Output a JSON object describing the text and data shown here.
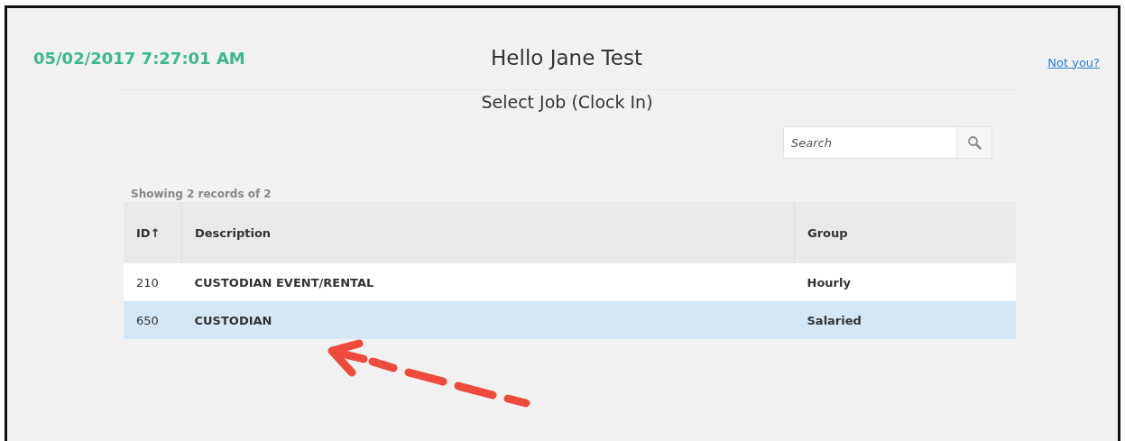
{
  "timestamp": "05/02/2017 7:27:01 AM",
  "greeting": "Hello Jane Test",
  "not_you_link": "Not you?",
  "subtitle": "Select Job (Clock In)",
  "search": {
    "placeholder": "Search"
  },
  "records_summary": "Showing 2 records of 2",
  "table": {
    "columns": [
      {
        "label": "ID",
        "sort_icon": "↑"
      },
      {
        "label": "Description"
      },
      {
        "label": "Group"
      }
    ],
    "rows": [
      {
        "id": "210",
        "description": "CUSTODIAN EVENT/RENTAL",
        "group": "Hourly",
        "selected": false
      },
      {
        "id": "650",
        "description": "CUSTODIAN",
        "group": "Salaried",
        "selected": true
      }
    ]
  }
}
